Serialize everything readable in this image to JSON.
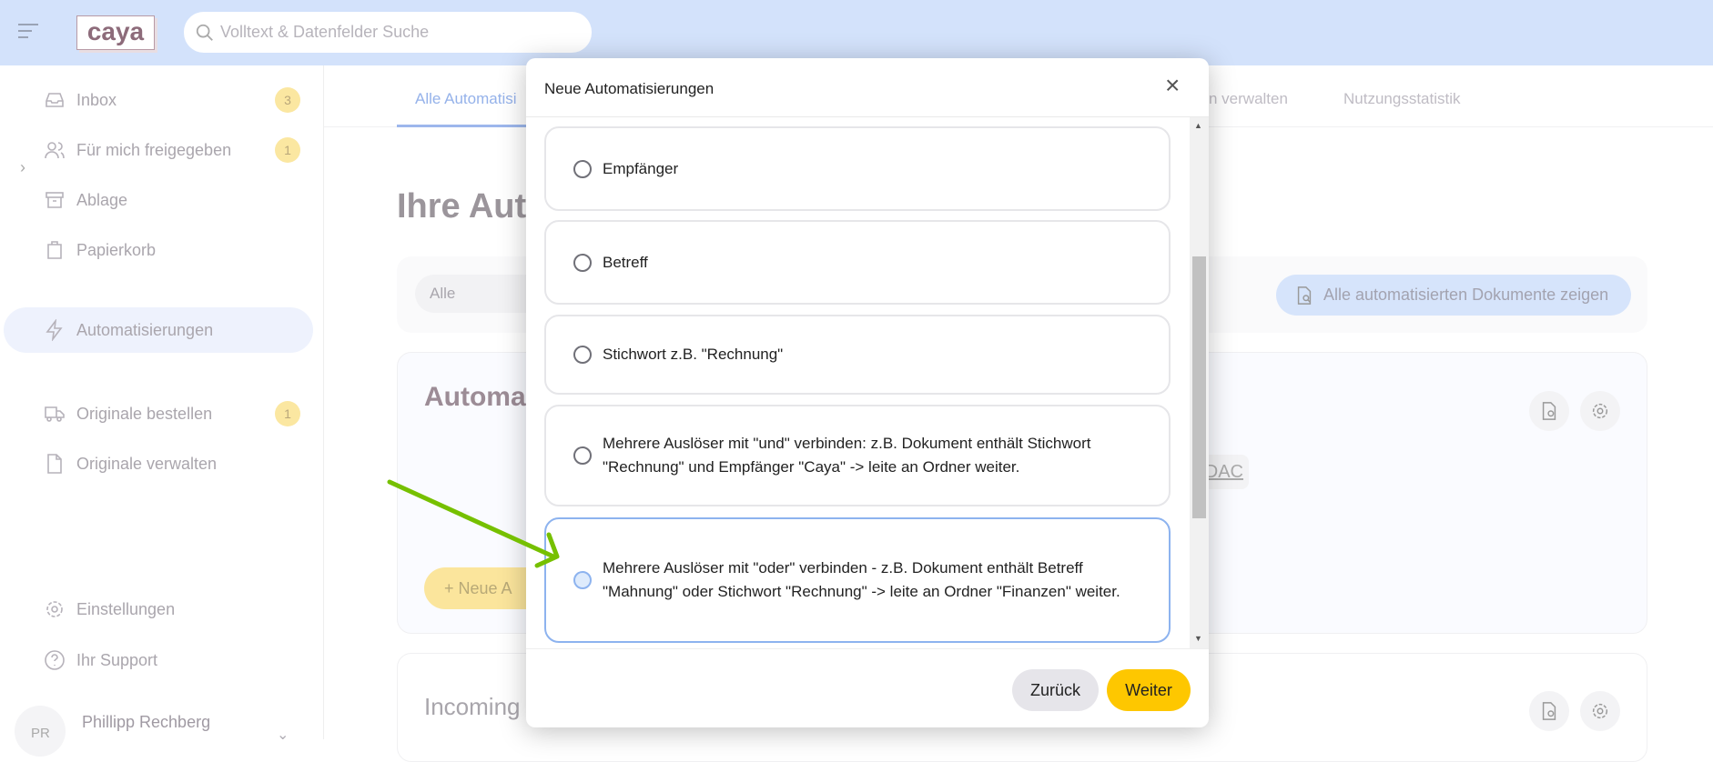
{
  "header": {
    "logo": "caya",
    "search_placeholder": "Volltext & Datenfelder Suche"
  },
  "sidebar": {
    "items": [
      {
        "label": "Inbox",
        "badge": "3",
        "icon": "inbox-icon"
      },
      {
        "label": "Für mich freigegeben",
        "badge": "1",
        "icon": "users-icon"
      },
      {
        "label": "Ablage",
        "icon": "archive-icon"
      },
      {
        "label": "Papierkorb",
        "icon": "trash-icon"
      },
      {
        "label": "Automatisierungen",
        "icon": "lightning-icon",
        "active": true
      },
      {
        "label": "Originale bestellen",
        "badge": "1",
        "icon": "truck-icon"
      },
      {
        "label": "Originale verwalten",
        "icon": "file-icon"
      },
      {
        "label": "Einstellungen",
        "icon": "gear-icon"
      },
      {
        "label": "Ihr Support",
        "icon": "help-icon"
      }
    ],
    "user": {
      "initials": "PR",
      "name": "Phillipp Rechberg"
    }
  },
  "tabs": [
    "Alle Automatisi",
    "n verwalten",
    "Nutzungsstatistik"
  ],
  "main": {
    "title": "Ihre Aut",
    "filter": "Alle",
    "show_docs": "Alle automatisierten Dokumente zeigen",
    "card1": {
      "title": "Automa",
      "chip": "DAC",
      "new_button": "Neue A"
    },
    "card2": {
      "title": "Incoming"
    }
  },
  "modal": {
    "title": "Neue Automatisierungen",
    "options": [
      {
        "label": "Empfänger",
        "selected": false
      },
      {
        "label": "Betreff",
        "selected": false
      },
      {
        "label": "Stichwort z.B. \"Rechnung\"",
        "selected": false
      },
      {
        "label": "Mehrere Auslöser mit \"und\" verbinden: z.B. Dokument enthält Stichwort \"Rechnung\" und Empfänger \"Caya\" -> leite an Ordner weiter.",
        "selected": false
      },
      {
        "label": "Mehrere Auslöser mit \"oder\" verbinden - z.B. Dokument enthält Betreff \"Mahnung\" oder Stichwort \"Rechnung\" -> leite an Ordner \"Finanzen\" weiter.",
        "selected": true
      }
    ],
    "back": "Zurück",
    "next": "Weiter"
  },
  "colors": {
    "accent": "#fec700",
    "selected_border": "#8db3ef",
    "annotation_arrow": "#76c000",
    "header_bg": "#d3e2fb"
  }
}
